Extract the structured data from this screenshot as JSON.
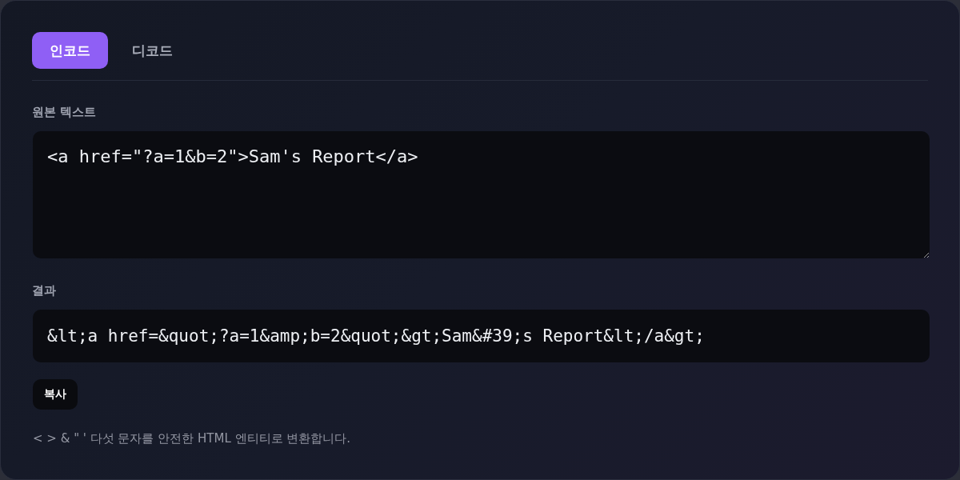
{
  "tabs": [
    {
      "label": "인코드",
      "selected": true
    },
    {
      "label": "디코드",
      "selected": false
    }
  ],
  "source": {
    "label": "원본 텍스트",
    "value": "<a href=\"?a=1&b=2\">Sam's Report</a>"
  },
  "result": {
    "label": "결과",
    "value": "&lt;a href=&quot;?a=1&amp;b=2&quot;&gt;Sam&#39;s Report&lt;/a&gt;"
  },
  "copy_button": "복사",
  "note": "< > & \" ' 다섯 문자를 안전한 HTML 엔티티로 변환합니다."
}
